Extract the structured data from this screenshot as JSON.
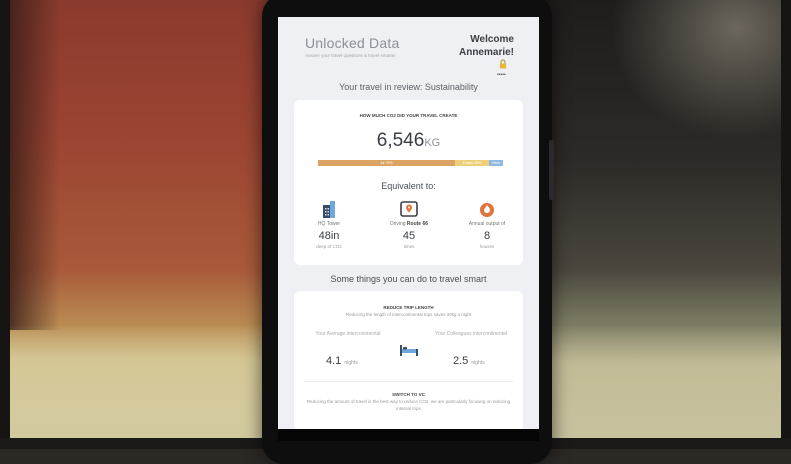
{
  "header": {
    "title": "Unlocked Data",
    "subtitle": "Answer your travel questions & travel smarter",
    "welcome_line1": "Welcome",
    "welcome_line2": "Annemarie!",
    "icons": [
      "lock-icon"
    ]
  },
  "review_heading": "Your travel in review: Sustainability",
  "co2_card": {
    "question": "HOW MUCH CO2 DID YOUR TRAVEL CREATE",
    "total_value": "6,546",
    "total_unit": "KG",
    "breakdown": [
      {
        "label": "Air 75%",
        "percent": 74,
        "color": "#dba462"
      },
      {
        "label": "Hotels 18%",
        "percent": 18,
        "color": "#efd07a"
      },
      {
        "label": "Other",
        "percent": 8,
        "color": "#8fb9e3"
      }
    ],
    "equivalent_heading": "Equivalent to:",
    "equivalents": [
      {
        "icon": "building-icon",
        "label": "HQ Tower",
        "label_bold": "",
        "value": "48in",
        "sub": "deep of CO2"
      },
      {
        "icon": "map-pin-icon",
        "label": "Driving",
        "label_bold": "Route 66",
        "value": "45",
        "sub": "times"
      },
      {
        "icon": "flame-icon",
        "label": "Annual output of",
        "label_bold": "",
        "value": "8",
        "sub": "houses"
      }
    ]
  },
  "tips_heading": "Some things you can do to travel smart",
  "tips": {
    "tip1_title": "REDUCE TRIP LENGTH",
    "tip1_desc": "Reducing the length of intercontinental trips saves 30kg a night",
    "your_average_label": "Your Average intercontinental",
    "your_average_value": "4.1",
    "your_average_unit": "nights",
    "colleagues_label": "Your Colleagues intercontinental",
    "colleagues_value": "2.5",
    "colleagues_unit": "nights",
    "tip2_title": "SWITCH TO VC",
    "tip2_desc": "Reducing the amount of travel is the best way to reduce CO2, we are particularly focusing on reducing internal trips"
  },
  "colors": {
    "accent_orange": "#dba462",
    "accent_yellow": "#efd07a",
    "accent_blue": "#8fb9e3",
    "flame": "#e0743c"
  }
}
